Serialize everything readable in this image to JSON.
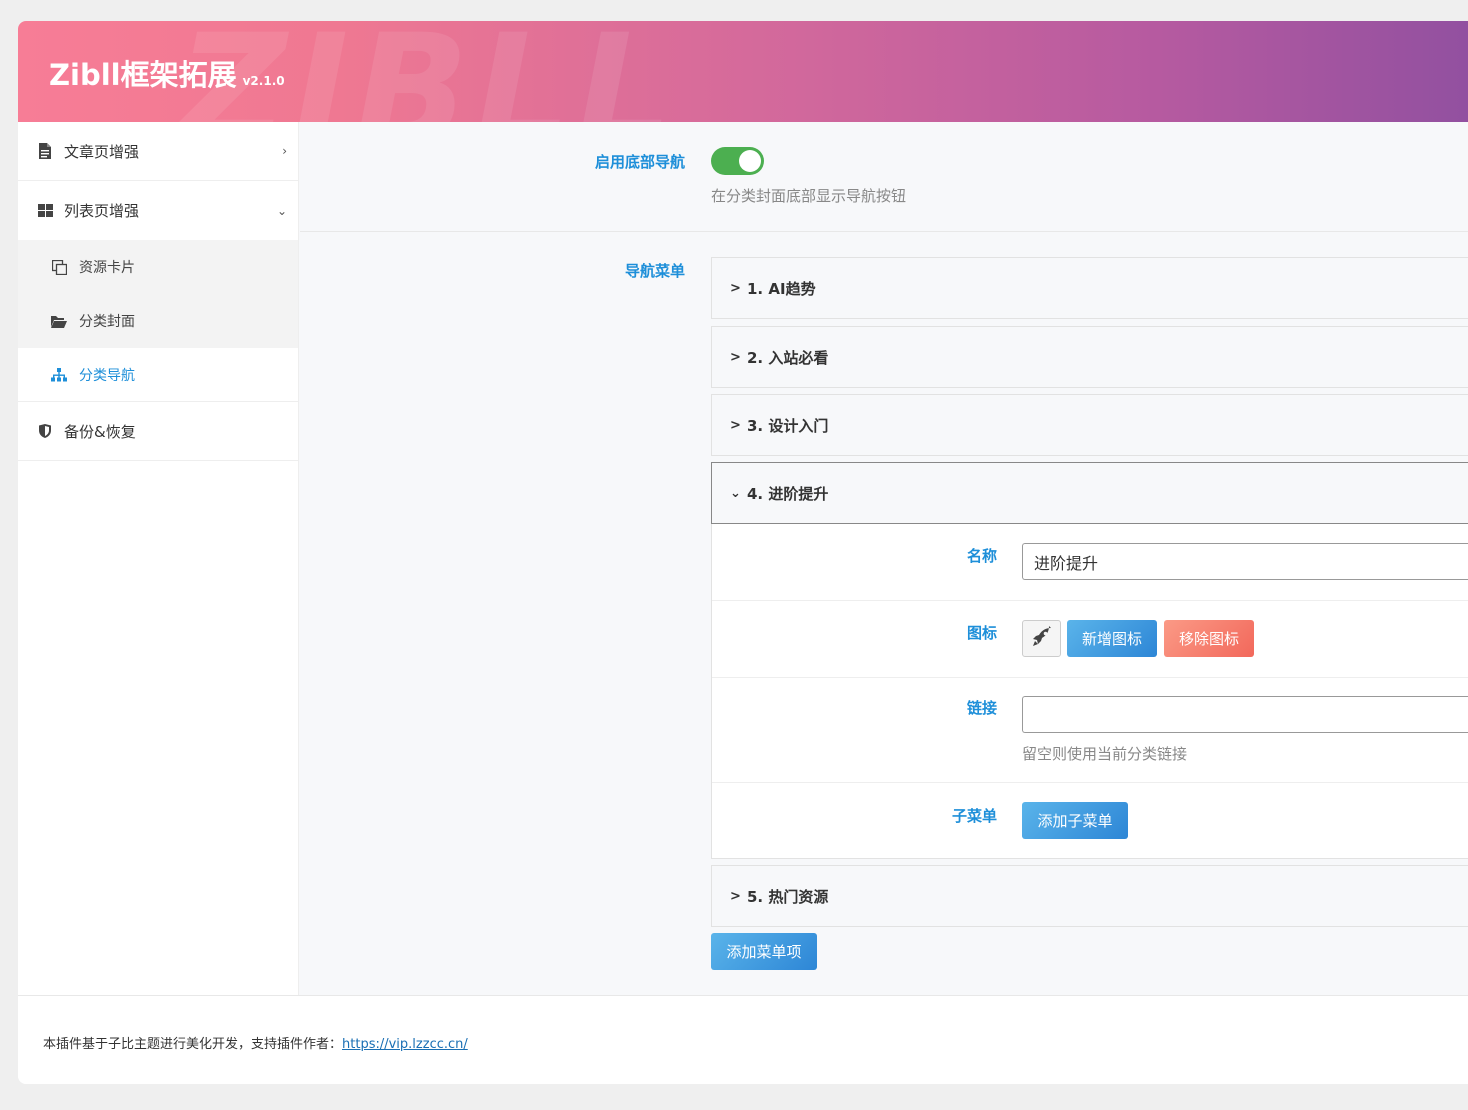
{
  "header": {
    "title": "Zibll框架拓展",
    "version": "v2.1.0",
    "watermark": "ZIBLL"
  },
  "sidebar": {
    "items": [
      {
        "label": "文章页增强",
        "icon": "document-icon"
      },
      {
        "label": "列表页增强",
        "icon": "grid-icon"
      },
      {
        "label": "备份&恢复",
        "icon": "shield-icon"
      }
    ],
    "sub_items": [
      {
        "label": "资源卡片",
        "icon": "copy-icon"
      },
      {
        "label": "分类封面",
        "icon": "folder-open-icon"
      },
      {
        "label": "分类导航",
        "icon": "sitemap-icon"
      }
    ]
  },
  "settings": {
    "bottom_nav": {
      "label": "启用底部导航",
      "enabled": true,
      "hint": "在分类封面底部显示导航按钮"
    },
    "nav_menu": {
      "label": "导航菜单",
      "items": [
        {
          "index": "1.",
          "title": "AI趋势",
          "expanded": false
        },
        {
          "index": "2.",
          "title": "入站必看",
          "expanded": false
        },
        {
          "index": "3.",
          "title": "设计入门",
          "expanded": false
        },
        {
          "index": "4.",
          "title": "进阶提升",
          "expanded": true
        },
        {
          "index": "5.",
          "title": "热门资源",
          "expanded": false
        }
      ],
      "add_item_label": "添加菜单项"
    },
    "expanded_item": {
      "name_label": "名称",
      "name_value": "进阶提升",
      "icon_label": "图标",
      "icon_value": "rocket-icon",
      "add_icon_label": "新增图标",
      "remove_icon_label": "移除图标",
      "link_label": "链接",
      "link_value": "",
      "link_hint": "留空则使用当前分类链接",
      "submenu_label": "子菜单",
      "add_submenu_label": "添加子菜单"
    }
  },
  "footer": {
    "text": "本插件基于子比主题进行美化开发，支持插件作者：",
    "link_text": "https://vip.lzzcc.cn/"
  },
  "colors": {
    "accent": "#1e8fd9",
    "toggle_on": "#4caf50",
    "header_start": "#f77d96",
    "header_end": "#9150a0",
    "danger_button": "#f2685b"
  }
}
